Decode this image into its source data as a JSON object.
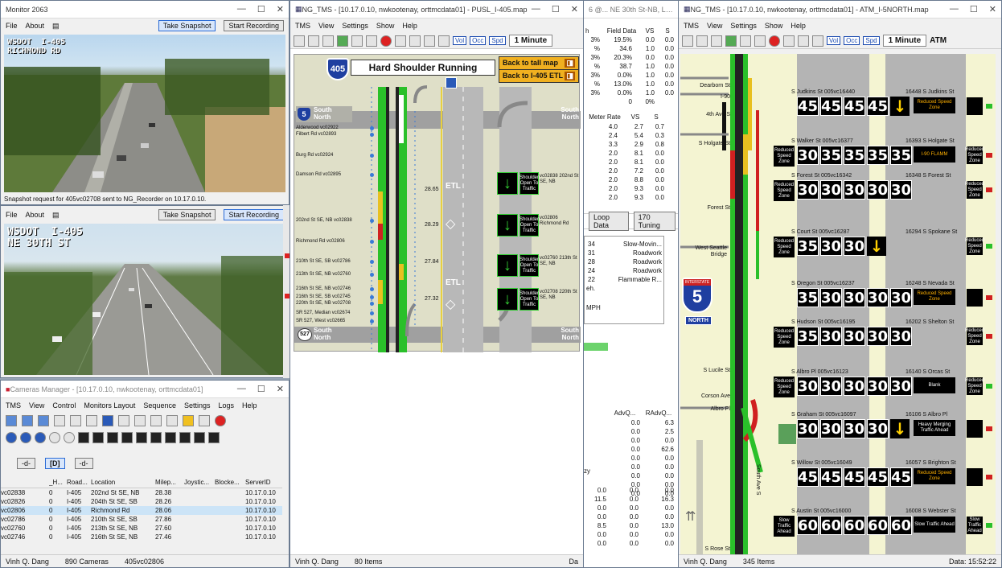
{
  "monitor1": {
    "title": "Monitor 2063",
    "menu": [
      "File",
      "About"
    ],
    "snapshot": "Take Snapshot",
    "record": "Start Recording",
    "overlay": "WSDOT  I-405\nRICHMOND RD",
    "status": "Snapshot request for 405vc02708 sent to NG_Recorder on 10.17.0.10."
  },
  "monitor2": {
    "menu": [
      "File",
      "About"
    ],
    "snapshot": "Take Snapshot",
    "record": "Start Recording",
    "overlay": "WSDOT  I-405\nNE 30TH ST"
  },
  "cammgr": {
    "title": "Cameras Manager - [10.17.0.10, nwkootenay, orttmcdata01]",
    "menu": [
      "TMS",
      "View",
      "Control",
      "Monitors Layout",
      "Sequence",
      "Settings",
      "Logs",
      "Help"
    ],
    "selector": [
      "-d-",
      "[D]",
      "-d-"
    ],
    "headers": [
      "_H...",
      "Road...",
      "Location",
      "Milep...",
      "Joystic...",
      "Blocke...",
      "ServerID"
    ],
    "rows": [
      [
        "vc02838",
        "0",
        "I-405",
        "202nd St SE, NB",
        "28.38",
        "",
        "",
        "10.17.0.10"
      ],
      [
        "vc02826",
        "0",
        "I-405",
        "204th St SE, SB",
        "28.26",
        "",
        "",
        "10.17.0.10"
      ],
      [
        "vc02806",
        "0",
        "I-405",
        "Richmond Rd",
        "28.06",
        "",
        "",
        "10.17.0.10"
      ],
      [
        "vc02786",
        "0",
        "I-405",
        "210th St SE, SB",
        "27.86",
        "",
        "",
        "10.17.0.10"
      ],
      [
        "vc02760",
        "0",
        "I-405",
        "213th St SE, NB",
        "27.60",
        "",
        "",
        "10.17.0.10"
      ],
      [
        "vc02746",
        "0",
        "I-405",
        "216th St SE, NB",
        "27.46",
        "",
        "",
        "10.17.0.10"
      ]
    ],
    "status": [
      "Vinh Q. Dang",
      "890 Cameras",
      "405vc02806"
    ]
  },
  "pusl": {
    "title": "NG_TMS - [10.17.0.10, nwkootenay, orttmcdata01] - PUSL_I-405.map",
    "menu": [
      "TMS",
      "View",
      "Settings",
      "Show",
      "Help"
    ],
    "interval": "1 Minute",
    "tbtn": [
      "Vol",
      "Occ",
      "Spd"
    ],
    "shield": "405",
    "heading": "Hard Shoulder Running",
    "back_tall": "Back to tall map",
    "back_etl": "Back to I-405 ETL",
    "south": "South",
    "north": "North",
    "shield5": "5",
    "shield527": "527",
    "etl": "ETL",
    "cams": [
      "Alderwood vc02922",
      "Filbert Rd vc02893",
      "Burg Rd vc02924",
      "Damson Rd vc02895",
      "202nd St SE, NB vc02838",
      "Richmond Rd vc02806",
      "210th St SE, SB vc02786",
      "213th St SE, NB vc02760",
      "216th St SE, NB vc02746",
      "216th St SE, SB vc02745",
      "220th St SE, NB vc02708",
      "SR 527, Median vc02674",
      "SR 527, West vc02665"
    ],
    "mileposts": [
      "28.65",
      "28.29",
      "27.84",
      "27.32"
    ],
    "signs": [
      {
        "label": "vc02838 202nd St SE, NB",
        "text": "Shoulder Open To Traffic"
      },
      {
        "label": "vc02806 Richmond Rd",
        "text": "Shoulder Open To Traffic"
      },
      {
        "label": "vc02760 213th St SE, NB",
        "text": "Shoulder Open To Traffic"
      },
      {
        "label": "vc02708 220th St SE, NB",
        "text": "Shoulder Open To Traffic"
      }
    ],
    "status": [
      "Vinh Q. Dang",
      "80 Items",
      "Da"
    ]
  },
  "mid": {
    "title_frag": "6 @... NE 30th St-NB, Lane 2, (M)",
    "fd_headers": [
      "h",
      "Field Data",
      "VS",
      "S"
    ],
    "fd_rows": [
      [
        "3%",
        "19.5%",
        "0.0",
        "0.0"
      ],
      [
        "%",
        "34.6",
        "1.0",
        "0.0"
      ],
      [
        "3%",
        "20.3%",
        "0.0",
        "0.0"
      ],
      [
        "%",
        "38.7",
        "1.0",
        "0.0"
      ],
      [
        "3%",
        "0.0%",
        "1.0",
        "0.0"
      ],
      [
        "%",
        "13.0%",
        "1.0",
        "0.0"
      ],
      [
        "3%",
        "0.0%",
        "1.0",
        "0.0"
      ],
      [
        "",
        "0",
        "0%",
        ""
      ]
    ],
    "meter_headers": [
      "Meter Rate",
      "VS",
      "S"
    ],
    "meter_rows": [
      [
        "4.0",
        "2.7",
        "0.7"
      ],
      [
        "2.4",
        "5.4",
        "0.3"
      ],
      [
        "3.3",
        "2.9",
        "0.8"
      ],
      [
        "2.0",
        "8.1",
        "0.0"
      ],
      [
        "2.0",
        "8.1",
        "0.0"
      ],
      [
        "2.0",
        "7.2",
        "0.0"
      ],
      [
        "2.0",
        "8.8",
        "0.0"
      ],
      [
        "2.0",
        "9.3",
        "0.0"
      ],
      [
        "2.0",
        "9.3",
        "0.0"
      ]
    ],
    "tabs": [
      "Loop Data",
      "170 Tuning"
    ],
    "events": [
      [
        "34",
        "Slow-Movin..."
      ],
      [
        "31",
        "Roadwork"
      ],
      [
        "28",
        "Roadwork"
      ],
      [
        "24",
        "Roadwork"
      ],
      [
        "22",
        "Flammable R..."
      ]
    ],
    "ev_side": [
      "eh.",
      "MPH"
    ],
    "adv_headers": [
      "AdvQ...",
      "RAdvQ..."
    ],
    "adv_rows": [
      [
        "0.0",
        "6.3"
      ],
      [
        "0.0",
        "2.5"
      ],
      [
        "0.0",
        "0.0"
      ],
      [
        "0.0",
        "62.6"
      ],
      [
        "0.0",
        "0.0"
      ],
      [
        "0.0",
        "0.0"
      ],
      [
        "0.0",
        "0.0"
      ],
      [
        "0.0",
        "0.0"
      ],
      [
        "0.0",
        "0.0"
      ]
    ],
    "low_rows": [
      [
        "0.0",
        "0.0",
        "0.0"
      ],
      [
        "11.5",
        "0.0",
        "16.3"
      ],
      [
        "0.0",
        "0.0",
        "0.0"
      ],
      [
        "0.0",
        "0.0",
        "0.0"
      ],
      [
        "8.5",
        "0.0",
        "13.0"
      ],
      [
        "0.0",
        "0.0",
        "0.0"
      ],
      [
        "0.0",
        "0.0",
        "0.0"
      ]
    ],
    "low_label": "zy"
  },
  "atm": {
    "title": "NG_TMS - [10.17.0.10, nwkootenay, orttmcdata01] - ATM_I-5NORTH.map",
    "menu": [
      "TMS",
      "View",
      "Settings",
      "Show",
      "Help"
    ],
    "interval": "1 Minute",
    "atm_label": "ATM",
    "tbtn": [
      "Vol",
      "Occ",
      "Spd"
    ],
    "left_labels": [
      "Dearborn St",
      "I-90",
      "4th Ave S",
      "S Holgate St",
      "Forest St",
      "West Seattle Bridge",
      "S Lucile St",
      "Corson Ave",
      "Albro Pl",
      "S Rose St"
    ],
    "interstate": "INTERSTATE",
    "i5": "5",
    "north": "NORTH",
    "vert_road": "South Ave S",
    "rows": [
      {
        "loc": "S Judkins St 005vc16440",
        "right": "16448 S Judkins St",
        "speeds": [
          "45",
          "45",
          "45",
          "45"
        ],
        "vms": "Reduced Speed Zone",
        "left_vms": ""
      },
      {
        "loc": "S Walker St 005vc16377",
        "right": "16393 S Holgate St",
        "speeds": [
          "30",
          "35",
          "35",
          "35",
          "35"
        ],
        "vms": "I-90 FLAMM",
        "left_vms": "Reduced Speed Zone"
      },
      {
        "loc": "S Forest St 005vc16342",
        "right": "16348 S Forest St",
        "speeds": [
          "30",
          "30",
          "30",
          "30",
          "30"
        ],
        "vms": "",
        "left_vms": "Reduced Speed Zone"
      },
      {
        "loc": "S Court St 005vc16287",
        "right": "16294 S Spokane St",
        "speeds": [
          "35",
          "30",
          "30"
        ],
        "vms": "",
        "left_vms": "Reduced Speed Zone"
      },
      {
        "loc": "S Oregon St 005vc16237",
        "right": "16248 S Nevada St",
        "speeds": [
          "35",
          "30",
          "30",
          "30",
          "30"
        ],
        "vms": "Reduced Speed Zone",
        "left_vms": ""
      },
      {
        "loc": "S Hudson St 005vc16195",
        "right": "16202 S Shelton St",
        "speeds": [
          "35",
          "30",
          "30",
          "30",
          "30"
        ],
        "vms": "",
        "left_vms": "Reduced Speed Zone"
      },
      {
        "loc": "S Albro Pl 005vc16123",
        "right": "16140 S Orcas St",
        "speeds": [
          "30",
          "30",
          "30",
          "30",
          "30"
        ],
        "vms": "Blank",
        "left_vms": "Reduced Speed Zone"
      },
      {
        "loc": "S Graham St 005vc16097",
        "right": "16106 S Albro Pl",
        "speeds": [
          "30",
          "30",
          "30",
          "30"
        ],
        "vms": "Heavy Merging Traffic Ahead",
        "left_vms": ""
      },
      {
        "loc": "S Willow St 005vc16049",
        "right": "16057 S Brighton St",
        "speeds": [
          "45",
          "45",
          "45",
          "45",
          "45"
        ],
        "vms": "Reduced Speed Zone",
        "left_vms": ""
      },
      {
        "loc": "S Austin St 005vc16000",
        "right": "16008 S Webster St",
        "speeds": [
          "60",
          "60",
          "60",
          "60",
          "60"
        ],
        "vms": "Slow Traffic Ahead",
        "left_vms": "Slow Traffic Ahead"
      }
    ],
    "status": [
      "Vinh Q. Dang",
      "345 Items",
      "Data: 15:52:22"
    ]
  }
}
